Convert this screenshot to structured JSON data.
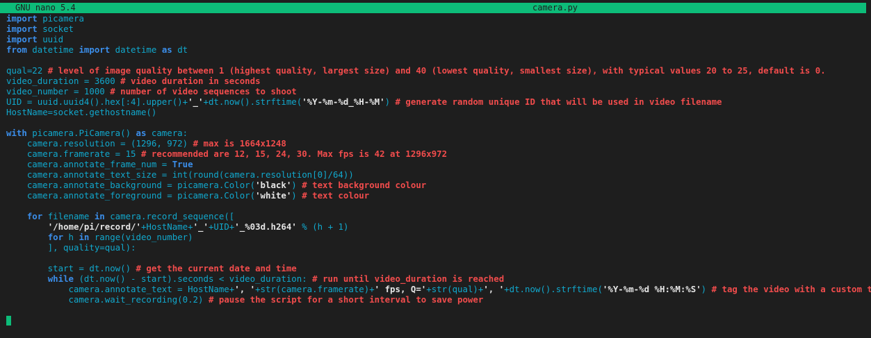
{
  "titlebar": {
    "app": "GNU nano 5.4",
    "file": "camera.py"
  },
  "colors": {
    "keyword": "#3b8eea",
    "identifier": "#11a8cd",
    "string": "#e5e5e5",
    "comment": "#f14c4c",
    "titlebar": "#0dbc79",
    "background": "#1e1e1e"
  },
  "lines": [
    [
      [
        "kw",
        "import"
      ],
      [
        "id",
        " picamera"
      ]
    ],
    [
      [
        "kw",
        "import"
      ],
      [
        "id",
        " socket"
      ]
    ],
    [
      [
        "kw",
        "import"
      ],
      [
        "id",
        " uuid"
      ]
    ],
    [
      [
        "kw",
        "from"
      ],
      [
        "id",
        " datetime "
      ],
      [
        "kw",
        "import"
      ],
      [
        "id",
        " datetime "
      ],
      [
        "kw",
        "as"
      ],
      [
        "id",
        " dt"
      ]
    ],
    [],
    [
      [
        "id",
        "qual=22 "
      ],
      [
        "cmt",
        "# level of image quality between 1 (highest quality, largest size) and 40 (lowest quality, smallest size), with typical values 20 to 25, default is 0."
      ]
    ],
    [
      [
        "id",
        "video_duration = 3600 "
      ],
      [
        "cmt",
        "# video duration in seconds"
      ]
    ],
    [
      [
        "id",
        "video_number = 1000 "
      ],
      [
        "cmt",
        "# number of video sequences to shoot"
      ]
    ],
    [
      [
        "id",
        "UID = uuid.uuid4().hex[:4].upper()+"
      ],
      [
        "str",
        "'_'"
      ],
      [
        "id",
        "+dt.now().strftime("
      ],
      [
        "str",
        "'%Y-%m-%d_%H-%M'"
      ],
      [
        "id",
        ") "
      ],
      [
        "cmt",
        "# generate random unique ID that will be used in video filename"
      ]
    ],
    [
      [
        "id",
        "HostName=socket.gethostname()"
      ]
    ],
    [],
    [
      [
        "kw",
        "with"
      ],
      [
        "id",
        " picamera.PiCamera() "
      ],
      [
        "kw",
        "as"
      ],
      [
        "id",
        " camera:"
      ]
    ],
    [
      [
        "id",
        "    camera.resolution = (1296, 972) "
      ],
      [
        "cmt",
        "# max is 1664x1248"
      ]
    ],
    [
      [
        "id",
        "    camera.framerate = 15 "
      ],
      [
        "cmt",
        "# recommended are 12, 15, 24, 30. Max fps is 42 at 1296x972"
      ]
    ],
    [
      [
        "id",
        "    camera.annotate_frame_num = "
      ],
      [
        "kw",
        "True"
      ]
    ],
    [
      [
        "id",
        "    camera.annotate_text_size = int(round(camera.resolution[0]/64))"
      ]
    ],
    [
      [
        "id",
        "    camera.annotate_background = picamera.Color("
      ],
      [
        "str",
        "'black'"
      ],
      [
        "id",
        ") "
      ],
      [
        "cmt",
        "# text background colour"
      ]
    ],
    [
      [
        "id",
        "    camera.annotate_foreground = picamera.Color("
      ],
      [
        "str",
        "'white'"
      ],
      [
        "id",
        ") "
      ],
      [
        "cmt",
        "# text colour"
      ]
    ],
    [],
    [
      [
        "id",
        "    "
      ],
      [
        "kw",
        "for"
      ],
      [
        "id",
        " filename "
      ],
      [
        "kw",
        "in"
      ],
      [
        "id",
        " camera.record_sequence(["
      ]
    ],
    [
      [
        "id",
        "        "
      ],
      [
        "str",
        "'/home/pi/record/'"
      ],
      [
        "id",
        "+HostName+"
      ],
      [
        "str",
        "'_'"
      ],
      [
        "id",
        "+UID+"
      ],
      [
        "str",
        "'_%03d.h264'"
      ],
      [
        "id",
        " % (h + 1)"
      ]
    ],
    [
      [
        "id",
        "        "
      ],
      [
        "kw",
        "for"
      ],
      [
        "id",
        " h "
      ],
      [
        "kw",
        "in"
      ],
      [
        "id",
        " range(video_number)"
      ]
    ],
    [
      [
        "id",
        "        ], quality=qual):"
      ]
    ],
    [],
    [
      [
        "id",
        "        start = dt.now() "
      ],
      [
        "cmt",
        "# get the current date and time"
      ]
    ],
    [
      [
        "id",
        "        "
      ],
      [
        "kw",
        "while"
      ],
      [
        "id",
        " (dt.now() - start).seconds < video_duration: "
      ],
      [
        "cmt",
        "# run until video_duration is reached"
      ]
    ],
    [
      [
        "id",
        "            camera.annotate_text = HostName+"
      ],
      [
        "str",
        "', '"
      ],
      [
        "id",
        "+str(camera.framerate)+"
      ],
      [
        "str",
        "' fps, Q='"
      ],
      [
        "id",
        "+str(qual)+"
      ],
      [
        "str",
        "', '"
      ],
      [
        "id",
        "+dt.now().strftime("
      ],
      [
        "str",
        "'%Y-%m-%d %H:%M:%S'"
      ],
      [
        "id",
        ") "
      ],
      [
        "cmt",
        "# tag the video with a custom text"
      ]
    ],
    [
      [
        "id",
        "            camera.wait_recording(0.2) "
      ],
      [
        "cmt",
        "# pause the script for a short interval to save power"
      ]
    ]
  ]
}
